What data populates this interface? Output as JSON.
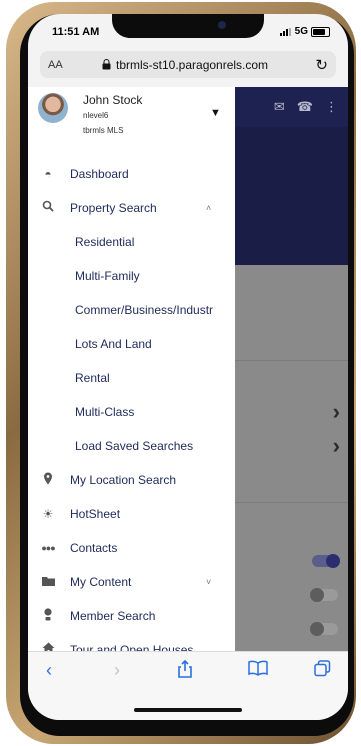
{
  "status": {
    "time": "11:51 AM",
    "network": "5G"
  },
  "browser": {
    "text_size": "AA",
    "url": "tbrmls-st10.paragonrels.com",
    "reload_icon": "reload-icon"
  },
  "profile": {
    "name": "John Stock",
    "level": "nlevel6",
    "mls": "tbrmls MLS"
  },
  "menu": {
    "items": [
      {
        "label": "Dashboard",
        "icon": "dashboard-icon"
      },
      {
        "label": "Property Search",
        "icon": "search-icon",
        "expanded": true
      },
      {
        "label": "My Location Search",
        "icon": "location-pin-icon"
      },
      {
        "label": "HotSheet",
        "icon": "hotsheet-icon"
      },
      {
        "label": "Contacts",
        "icon": "contacts-icon"
      },
      {
        "label": "My Content",
        "icon": "folder-icon",
        "expanded": false
      },
      {
        "label": "Member Search",
        "icon": "member-icon"
      },
      {
        "label": "Tour and Open Houses",
        "icon": "house-icon"
      }
    ],
    "property_search_sub": [
      "Residential",
      "Multi-Family",
      "Commer/Business/Industr",
      "Lots And Land",
      "Rental",
      "Multi-Class",
      "Load Saved Searches"
    ]
  },
  "toggles": [
    {
      "state": "on"
    },
    {
      "state": "off"
    },
    {
      "state": "off"
    }
  ],
  "toolbar": {
    "icons": [
      "back-icon",
      "forward-icon",
      "share-icon",
      "bookmarks-icon",
      "tabs-icon"
    ]
  }
}
